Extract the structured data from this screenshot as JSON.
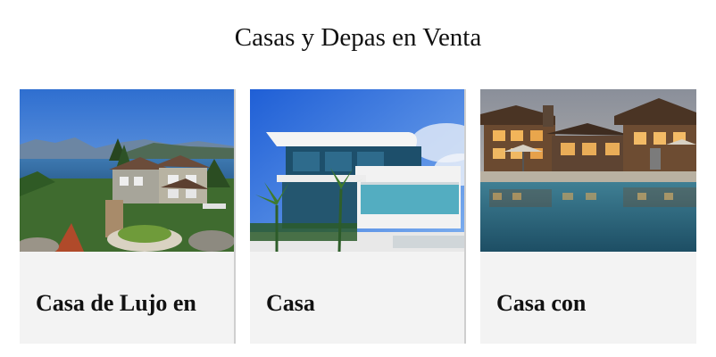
{
  "page": {
    "title": "Casas y Depas en Venta"
  },
  "cards": [
    {
      "title": "Casa de Lujo en",
      "image": "lakeside-luxury-house-photo"
    },
    {
      "title": "Casa",
      "image": "modern-white-house-photo"
    },
    {
      "title": "Casa con",
      "image": "cabin-house-with-pool-photo"
    }
  ]
}
